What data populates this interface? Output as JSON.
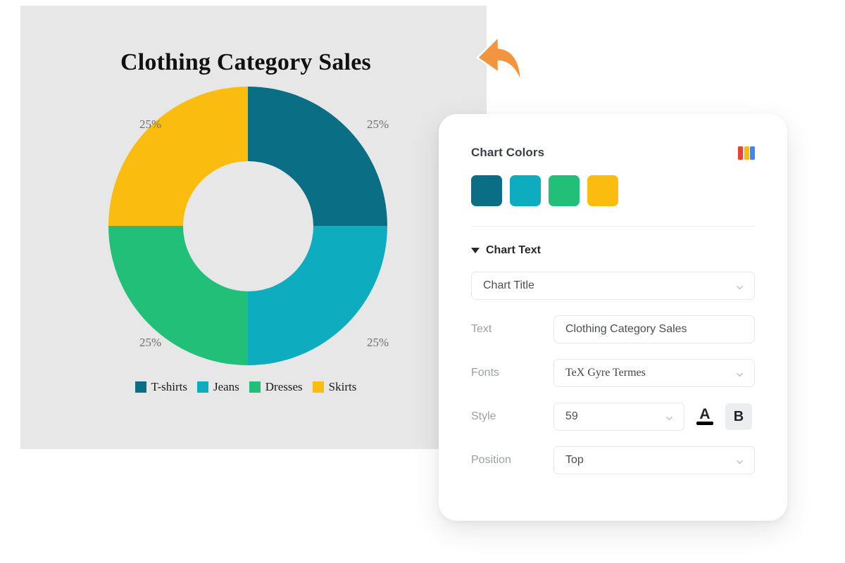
{
  "chart_data": {
    "type": "pie",
    "variant": "donut",
    "title": "Clothing Category Sales",
    "categories": [
      "T-shirts",
      "Jeans",
      "Dresses",
      "Skirts"
    ],
    "values": [
      25,
      25,
      25,
      25
    ],
    "value_labels": [
      "25%",
      "25%",
      "25%",
      "25%"
    ],
    "colors": [
      "#0A6E85",
      "#0DACBF",
      "#22BF79",
      "#FBBC10"
    ],
    "legend_position": "bottom",
    "grid": false,
    "title_position": "Top",
    "title_font": "TeX Gyre Termes",
    "background": "#e7e7e7"
  },
  "chart_preview": {
    "title": "Clothing Category Sales",
    "percent_top_left": "25%",
    "percent_top_right": "25%",
    "percent_bottom_left": "25%",
    "percent_bottom_right": "25%",
    "legend": [
      {
        "label": "T-shirts",
        "color": "#0A6E85"
      },
      {
        "label": "Jeans",
        "color": "#0DACBF"
      },
      {
        "label": "Dresses",
        "color": "#22BF79"
      },
      {
        "label": "Skirts",
        "color": "#FBBC10"
      }
    ]
  },
  "cursor": {
    "color": "#F2953E"
  },
  "panel": {
    "chart_colors": {
      "heading": "Chart Colors",
      "palette_icon_colors": [
        "#EA4335",
        "#FBBC05",
        "#4285F4"
      ],
      "swatches": [
        "#0A6E85",
        "#0DACBF",
        "#22BF79",
        "#FBBC10"
      ]
    },
    "chart_text": {
      "heading": "Chart Text",
      "target_select": "Chart Title",
      "rows": {
        "text": {
          "label": "Text",
          "value": "Clothing Category Sales"
        },
        "fonts": {
          "label": "Fonts",
          "value": "TeX Gyre Termes"
        },
        "style": {
          "label": "Style",
          "value": "59",
          "color_icon": "A",
          "bold_icon": "B"
        },
        "position": {
          "label": "Position",
          "value": "Top"
        }
      }
    }
  }
}
